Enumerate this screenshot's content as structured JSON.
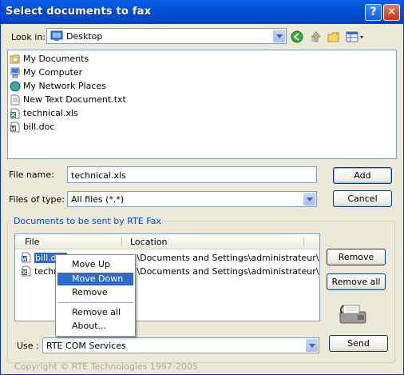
{
  "window": {
    "title": "Select documents to fax",
    "help_label": "?",
    "close_label": "✕"
  },
  "look_in": {
    "label": "Look in:",
    "value": "Desktop"
  },
  "file_list": [
    {
      "name": "My Documents",
      "icon": "my-documents-icon"
    },
    {
      "name": "My Computer",
      "icon": "my-computer-icon"
    },
    {
      "name": "My Network Places",
      "icon": "network-places-icon"
    },
    {
      "name": "New Text Document.txt",
      "icon": "text-file-icon"
    },
    {
      "name": "technical.xls",
      "icon": "excel-file-icon"
    },
    {
      "name": "bill.doc",
      "icon": "word-file-icon"
    }
  ],
  "file_name": {
    "label": "File name:",
    "value": "technical.xls"
  },
  "files_of_type": {
    "label": "Files of type:",
    "value": "All files (*.*)"
  },
  "buttons": {
    "add": "Add",
    "cancel": "Cancel",
    "remove": "Remove",
    "remove_all": "Remove all",
    "send": "Send"
  },
  "documents_group": {
    "title": "Documents to be sent by RTE Fax",
    "columns": [
      "File",
      "Location"
    ],
    "rows": [
      {
        "file": "bill.doc",
        "location": "C:\\Documents and Settings\\administrateur\\..."
      },
      {
        "file": "technical.xls",
        "location": "C:\\Documents and Settings\\administrateur\\..."
      }
    ]
  },
  "context_menu": {
    "items": [
      "Move Up",
      "Move Down",
      "Remove",
      "Remove all",
      "About..."
    ],
    "selected": "Move Down"
  },
  "use": {
    "label": "Use :",
    "value": "RTE COM Services"
  },
  "footer": "Copyright © RTE Technologies 1997-2005"
}
